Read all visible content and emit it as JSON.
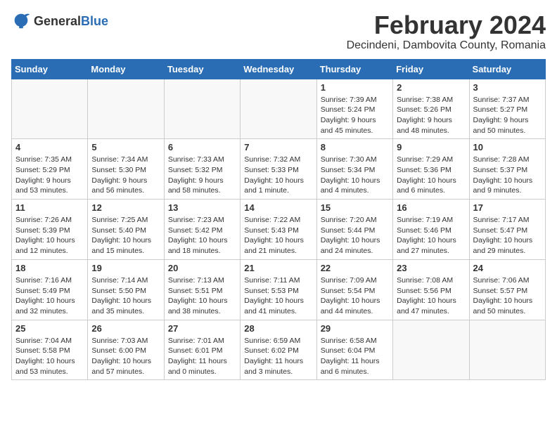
{
  "header": {
    "logo_general": "General",
    "logo_blue": "Blue",
    "month_title": "February 2024",
    "subtitle": "Decindeni, Dambovita County, Romania"
  },
  "weekdays": [
    "Sunday",
    "Monday",
    "Tuesday",
    "Wednesday",
    "Thursday",
    "Friday",
    "Saturday"
  ],
  "weeks": [
    [
      {
        "day": "",
        "sunrise": "",
        "sunset": "",
        "daylight": ""
      },
      {
        "day": "",
        "sunrise": "",
        "sunset": "",
        "daylight": ""
      },
      {
        "day": "",
        "sunrise": "",
        "sunset": "",
        "daylight": ""
      },
      {
        "day": "",
        "sunrise": "",
        "sunset": "",
        "daylight": ""
      },
      {
        "day": "1",
        "sunrise": "Sunrise: 7:39 AM",
        "sunset": "Sunset: 5:24 PM",
        "daylight": "Daylight: 9 hours and 45 minutes."
      },
      {
        "day": "2",
        "sunrise": "Sunrise: 7:38 AM",
        "sunset": "Sunset: 5:26 PM",
        "daylight": "Daylight: 9 hours and 48 minutes."
      },
      {
        "day": "3",
        "sunrise": "Sunrise: 7:37 AM",
        "sunset": "Sunset: 5:27 PM",
        "daylight": "Daylight: 9 hours and 50 minutes."
      }
    ],
    [
      {
        "day": "4",
        "sunrise": "Sunrise: 7:35 AM",
        "sunset": "Sunset: 5:29 PM",
        "daylight": "Daylight: 9 hours and 53 minutes."
      },
      {
        "day": "5",
        "sunrise": "Sunrise: 7:34 AM",
        "sunset": "Sunset: 5:30 PM",
        "daylight": "Daylight: 9 hours and 56 minutes."
      },
      {
        "day": "6",
        "sunrise": "Sunrise: 7:33 AM",
        "sunset": "Sunset: 5:32 PM",
        "daylight": "Daylight: 9 hours and 58 minutes."
      },
      {
        "day": "7",
        "sunrise": "Sunrise: 7:32 AM",
        "sunset": "Sunset: 5:33 PM",
        "daylight": "Daylight: 10 hours and 1 minute."
      },
      {
        "day": "8",
        "sunrise": "Sunrise: 7:30 AM",
        "sunset": "Sunset: 5:34 PM",
        "daylight": "Daylight: 10 hours and 4 minutes."
      },
      {
        "day": "9",
        "sunrise": "Sunrise: 7:29 AM",
        "sunset": "Sunset: 5:36 PM",
        "daylight": "Daylight: 10 hours and 6 minutes."
      },
      {
        "day": "10",
        "sunrise": "Sunrise: 7:28 AM",
        "sunset": "Sunset: 5:37 PM",
        "daylight": "Daylight: 10 hours and 9 minutes."
      }
    ],
    [
      {
        "day": "11",
        "sunrise": "Sunrise: 7:26 AM",
        "sunset": "Sunset: 5:39 PM",
        "daylight": "Daylight: 10 hours and 12 minutes."
      },
      {
        "day": "12",
        "sunrise": "Sunrise: 7:25 AM",
        "sunset": "Sunset: 5:40 PM",
        "daylight": "Daylight: 10 hours and 15 minutes."
      },
      {
        "day": "13",
        "sunrise": "Sunrise: 7:23 AM",
        "sunset": "Sunset: 5:42 PM",
        "daylight": "Daylight: 10 hours and 18 minutes."
      },
      {
        "day": "14",
        "sunrise": "Sunrise: 7:22 AM",
        "sunset": "Sunset: 5:43 PM",
        "daylight": "Daylight: 10 hours and 21 minutes."
      },
      {
        "day": "15",
        "sunrise": "Sunrise: 7:20 AM",
        "sunset": "Sunset: 5:44 PM",
        "daylight": "Daylight: 10 hours and 24 minutes."
      },
      {
        "day": "16",
        "sunrise": "Sunrise: 7:19 AM",
        "sunset": "Sunset: 5:46 PM",
        "daylight": "Daylight: 10 hours and 27 minutes."
      },
      {
        "day": "17",
        "sunrise": "Sunrise: 7:17 AM",
        "sunset": "Sunset: 5:47 PM",
        "daylight": "Daylight: 10 hours and 29 minutes."
      }
    ],
    [
      {
        "day": "18",
        "sunrise": "Sunrise: 7:16 AM",
        "sunset": "Sunset: 5:49 PM",
        "daylight": "Daylight: 10 hours and 32 minutes."
      },
      {
        "day": "19",
        "sunrise": "Sunrise: 7:14 AM",
        "sunset": "Sunset: 5:50 PM",
        "daylight": "Daylight: 10 hours and 35 minutes."
      },
      {
        "day": "20",
        "sunrise": "Sunrise: 7:13 AM",
        "sunset": "Sunset: 5:51 PM",
        "daylight": "Daylight: 10 hours and 38 minutes."
      },
      {
        "day": "21",
        "sunrise": "Sunrise: 7:11 AM",
        "sunset": "Sunset: 5:53 PM",
        "daylight": "Daylight: 10 hours and 41 minutes."
      },
      {
        "day": "22",
        "sunrise": "Sunrise: 7:09 AM",
        "sunset": "Sunset: 5:54 PM",
        "daylight": "Daylight: 10 hours and 44 minutes."
      },
      {
        "day": "23",
        "sunrise": "Sunrise: 7:08 AM",
        "sunset": "Sunset: 5:56 PM",
        "daylight": "Daylight: 10 hours and 47 minutes."
      },
      {
        "day": "24",
        "sunrise": "Sunrise: 7:06 AM",
        "sunset": "Sunset: 5:57 PM",
        "daylight": "Daylight: 10 hours and 50 minutes."
      }
    ],
    [
      {
        "day": "25",
        "sunrise": "Sunrise: 7:04 AM",
        "sunset": "Sunset: 5:58 PM",
        "daylight": "Daylight: 10 hours and 53 minutes."
      },
      {
        "day": "26",
        "sunrise": "Sunrise: 7:03 AM",
        "sunset": "Sunset: 6:00 PM",
        "daylight": "Daylight: 10 hours and 57 minutes."
      },
      {
        "day": "27",
        "sunrise": "Sunrise: 7:01 AM",
        "sunset": "Sunset: 6:01 PM",
        "daylight": "Daylight: 11 hours and 0 minutes."
      },
      {
        "day": "28",
        "sunrise": "Sunrise: 6:59 AM",
        "sunset": "Sunset: 6:02 PM",
        "daylight": "Daylight: 11 hours and 3 minutes."
      },
      {
        "day": "29",
        "sunrise": "Sunrise: 6:58 AM",
        "sunset": "Sunset: 6:04 PM",
        "daylight": "Daylight: 11 hours and 6 minutes."
      },
      {
        "day": "",
        "sunrise": "",
        "sunset": "",
        "daylight": ""
      },
      {
        "day": "",
        "sunrise": "",
        "sunset": "",
        "daylight": ""
      }
    ]
  ]
}
